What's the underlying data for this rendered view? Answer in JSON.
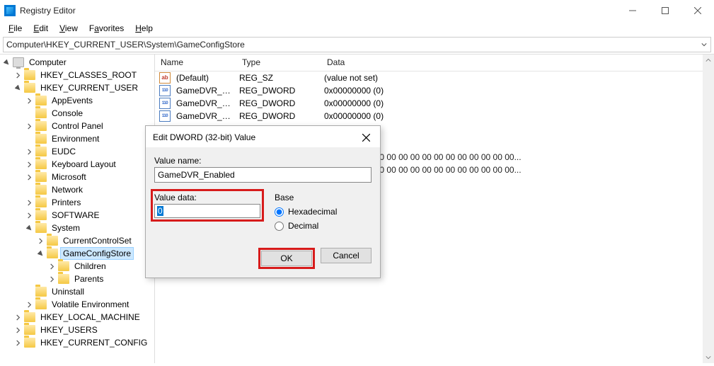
{
  "window": {
    "title": "Registry Editor"
  },
  "menu": {
    "file": "File",
    "edit": "Edit",
    "view": "View",
    "favorites": "Favorites",
    "help": "Help"
  },
  "address": "Computer\\HKEY_CURRENT_USER\\System\\GameConfigStore",
  "tree": {
    "root": "Computer",
    "hkcr": "HKEY_CLASSES_ROOT",
    "hkcu": "HKEY_CURRENT_USER",
    "hkcu_children": {
      "appevents": "AppEvents",
      "console": "Console",
      "controlpanel": "Control Panel",
      "environment": "Environment",
      "eudc": "EUDC",
      "keyboard": "Keyboard Layout",
      "microsoft": "Microsoft",
      "network": "Network",
      "printers": "Printers",
      "software": "SOFTWARE",
      "system": "System",
      "system_children": {
        "ccs": "CurrentControlSet",
        "gcs": "GameConfigStore",
        "gcs_children": {
          "children": "Children",
          "parents": "Parents"
        }
      },
      "uninstall": "Uninstall",
      "volatile": "Volatile Environment"
    },
    "hklm": "HKEY_LOCAL_MACHINE",
    "hku": "HKEY_USERS",
    "hkcc": "HKEY_CURRENT_CONFIG"
  },
  "list": {
    "headers": {
      "name": "Name",
      "type": "Type",
      "data": "Data"
    },
    "rows": [
      {
        "icon": "sz",
        "name": "(Default)",
        "type": "REG_SZ",
        "data": "(value not set)"
      },
      {
        "icon": "bin",
        "name": "GameDVR_DXGI...",
        "type": "REG_DWORD",
        "data": "0x00000000 (0)"
      },
      {
        "icon": "bin",
        "name": "GameDVR_EFSE...",
        "type": "REG_DWORD",
        "data": "0x00000000 (0)"
      },
      {
        "icon": "bin",
        "name": "GameDVR_Enabl...",
        "type": "REG_DWORD",
        "data": "0x00000000 (0)"
      }
    ],
    "overflow_binary": "00 00 00 00 00 00 00 00 00 00 00 00 00 00 00 00..."
  },
  "dialog": {
    "title": "Edit DWORD (32-bit) Value",
    "value_name_label": "Value name:",
    "value_name": "GameDVR_Enabled",
    "value_data_label": "Value data:",
    "value_data": "0",
    "base_label": "Base",
    "hex_label": "Hexadecimal",
    "dec_label": "Decimal",
    "ok": "OK",
    "cancel": "Cancel"
  }
}
